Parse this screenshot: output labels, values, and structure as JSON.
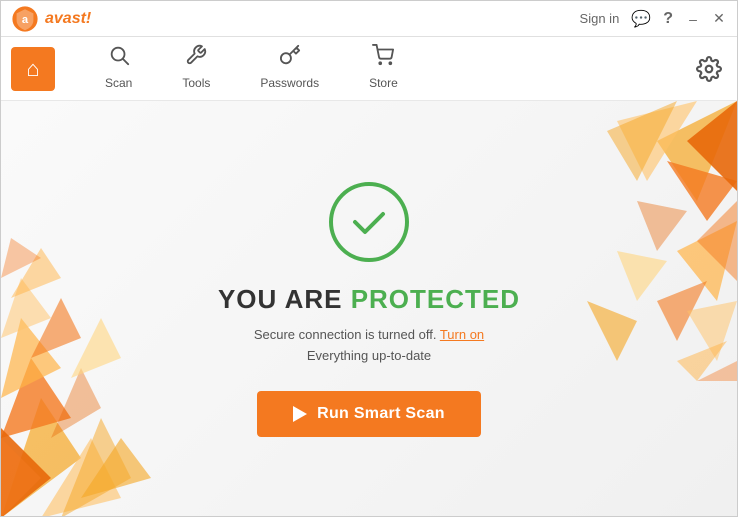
{
  "titlebar": {
    "logo_text": "avast!",
    "sign_in_label": "Sign in",
    "minimize_label": "–",
    "close_label": "✕"
  },
  "navbar": {
    "home_label": "Home",
    "items": [
      {
        "id": "scan",
        "icon": "search",
        "label": "Scan"
      },
      {
        "id": "tools",
        "icon": "tools",
        "label": "Tools"
      },
      {
        "id": "passwords",
        "icon": "key",
        "label": "Passwords"
      },
      {
        "id": "store",
        "icon": "store",
        "label": "Store"
      }
    ],
    "settings_label": "Settings"
  },
  "main": {
    "status_title_prefix": "YOU ARE ",
    "status_title_highlight": "PROTECTED",
    "status_line1_text": "Secure connection is turned off.",
    "status_line1_link": "Turn on",
    "status_line2": "Everything up-to-date",
    "scan_button_label": "Run Smart Scan"
  },
  "colors": {
    "orange": "#f47920",
    "green": "#4caf50",
    "dark_text": "#333",
    "light_text": "#555"
  }
}
